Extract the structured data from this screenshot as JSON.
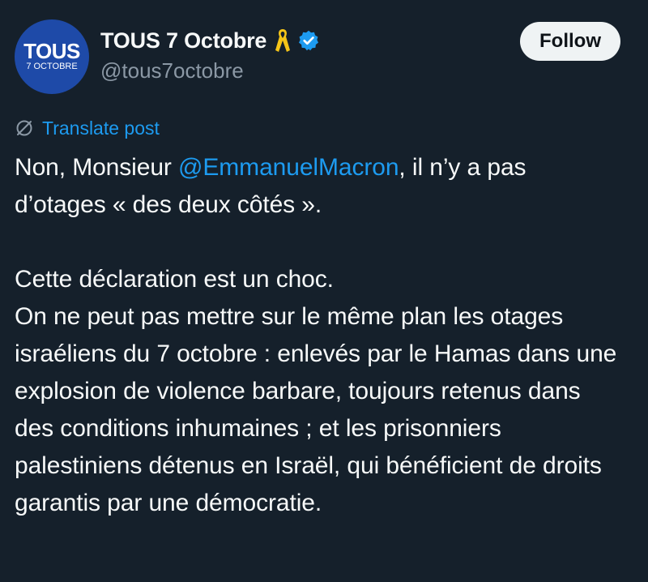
{
  "account": {
    "avatar_text_line1": "TOUS",
    "avatar_text_line2": "7 OCTOBRE",
    "display_name": "TOUS 7 Octobre",
    "handle": "@tous7octobre",
    "badge_icon": "yellow-ribbon-icon",
    "verified_icon": "verified-badge-icon",
    "verified_color": "#1d9bf0",
    "ribbon_color": "#f5c518"
  },
  "actions": {
    "follow_label": "Follow",
    "translate_label": "Translate post",
    "translate_icon": "globe-icon"
  },
  "post": {
    "para1_prefix": "Non, Monsieur ",
    "para1_mention": "@EmmanuelMacron",
    "para1_suffix": ", il n’y a pas d’otages « des deux côtés ».",
    "para2_line1": "Cette déclaration est un choc.",
    "para2_line2": "On ne peut pas mettre sur le même plan les otages israéliens du 7 octobre : enlevés par le Hamas dans une explosion de violence barbare, toujours retenus dans des conditions inhumaines ; et les prisonniers palestiniens détenus en Israël, qui bénéficient de droits garantis par une démocratie."
  },
  "colors": {
    "background": "#15202b",
    "text": "#f7f9f9",
    "secondary_text": "#8b98a5",
    "link": "#1d9bf0",
    "avatar_bg": "#1e4aa8",
    "follow_bg": "#eff3f4"
  }
}
